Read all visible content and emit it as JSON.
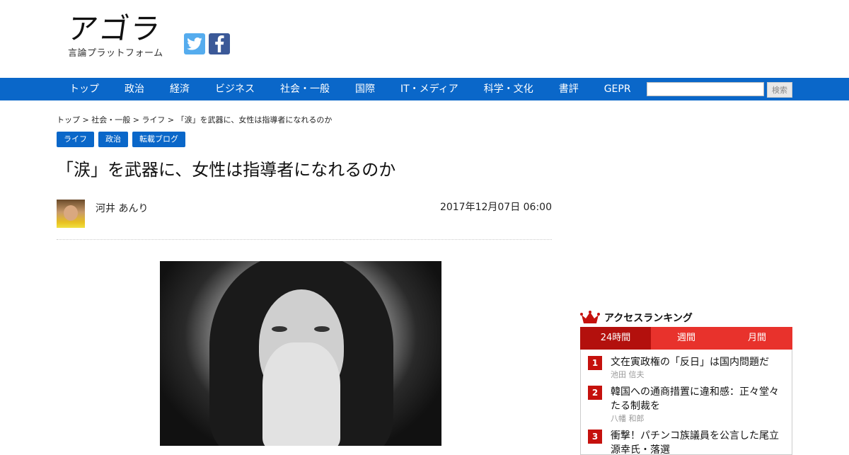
{
  "header": {
    "logo_text": "アゴラ",
    "logo_subtitle": "言論プラットフォーム",
    "social": [
      "twitter-icon",
      "facebook-icon"
    ]
  },
  "nav": {
    "items": [
      "トップ",
      "政治",
      "経済",
      "ビジネス",
      "社会・一般",
      "国際",
      "IT・メディア",
      "科学・文化",
      "書評",
      "GEPR"
    ],
    "search_button": "検索",
    "search_value": ""
  },
  "article": {
    "breadcrumb": {
      "items": [
        "トップ",
        "社会・一般",
        "ライフ"
      ],
      "separator": " > ",
      "current": "「涙」を武器に、女性は指導者になれるのか"
    },
    "tags": [
      "ライフ",
      "政治",
      "転載ブログ"
    ],
    "title": "「涙」を武器に、女性は指導者になれるのか",
    "author": "河井 あんり",
    "date": "2017年12月07日 06:00"
  },
  "ranking": {
    "title": "アクセスランキング",
    "tabs": [
      "24時間",
      "週間",
      "月間"
    ],
    "active_tab": "24時間",
    "items": [
      {
        "rank": "1",
        "title": "文在寅政権の「反日」は国内問題だ",
        "author": "池田 信夫"
      },
      {
        "rank": "2",
        "title": "韓国への通商措置に違和感：正々堂々たる制裁を",
        "author": "八幡 和郎"
      },
      {
        "rank": "3",
        "title": "衝撃！パチンコ族議員を公言した尾立源幸氏・落選",
        "author": ""
      }
    ]
  },
  "colors": {
    "nav_blue": "#0a67c9",
    "rank_red": "#e8322c",
    "rank_red_active": "#b3100d",
    "twitter": "#55acee",
    "facebook": "#3b5998"
  }
}
